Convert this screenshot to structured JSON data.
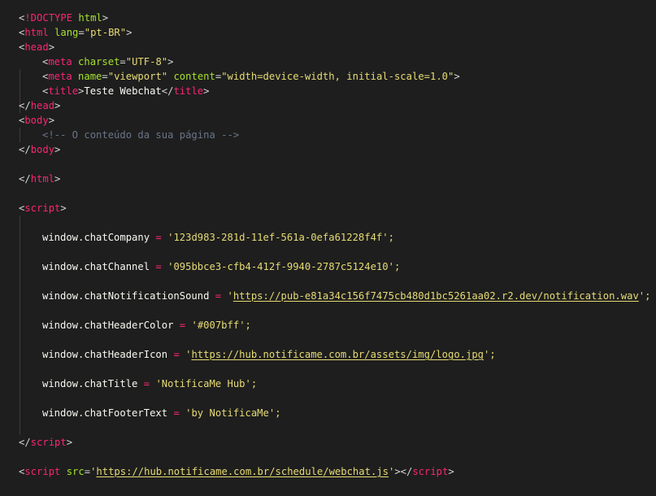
{
  "editor": {
    "language": "html",
    "theme_colors": {
      "background": "#1e1e1e",
      "tag": "#f92672",
      "attribute": "#a6e22e",
      "string": "#e6db74",
      "comment": "#6a7589",
      "text": "#f8f8f2"
    },
    "lines": {
      "l1": {
        "doctype_kw": "!DOCTYPE",
        "doctype_val": "html"
      },
      "l2": {
        "tag": "html",
        "attr": "lang",
        "val": "\"pt-BR\""
      },
      "l3": {
        "tag": "head"
      },
      "l4": {
        "tag": "meta",
        "attr": "charset",
        "val": "\"UTF-8\""
      },
      "l5": {
        "tag": "meta",
        "attr1": "name",
        "val1": "\"viewport\"",
        "attr2": "content",
        "val2": "\"width=device-width, initial-scale=1.0\""
      },
      "l6": {
        "tag": "title",
        "text": "Teste Webchat",
        "close_tag": "title"
      },
      "l7": {
        "tag": "head"
      },
      "l8": {
        "tag": "body"
      },
      "l9": {
        "comment": "<!-- O conteúdo da sua página -->"
      },
      "l10": {
        "tag": "body"
      },
      "l12": {
        "tag": "html"
      },
      "l14": {
        "tag": "script"
      },
      "l16": {
        "lhs": "window.chatCompany",
        "op": "=",
        "q": "'",
        "val": "123d983-281d-11ef-561a-0efa61228f4f",
        "end": "';"
      },
      "l18": {
        "lhs": "window.chatChannel",
        "op": "=",
        "q": "'",
        "val": "095bbce3-cfb4-412f-9940-2787c5124e10",
        "end": "';"
      },
      "l20": {
        "lhs": "window.chatNotificationSound",
        "op": "=",
        "q": "'",
        "val": "https://pub-e81a34c156f7475cb480d1bc5261aa02.r2.dev/notification.wav",
        "end": "';"
      },
      "l22": {
        "lhs": "window.chatHeaderColor",
        "op": "=",
        "q": "'",
        "val": "#007bff",
        "end": "';"
      },
      "l24": {
        "lhs": "window.chatHeaderIcon",
        "op": "=",
        "q": "'",
        "val": "https://hub.notificame.com.br/assets/img/logo.jpg",
        "end": "';"
      },
      "l26": {
        "lhs": "window.chatTitle",
        "op": "=",
        "q": "'",
        "val": "NotificaMe Hub",
        "end": "';"
      },
      "l28": {
        "lhs": "window.chatFooterText",
        "op": "=",
        "q": "'",
        "val": "by NotificaMe",
        "end": "';"
      },
      "l30": {
        "tag": "script"
      },
      "l32": {
        "tag": "script",
        "attr": "src",
        "q": "'",
        "val": "https://hub.notificame.com.br/schedule/webchat.js",
        "close_tag": "script"
      }
    }
  }
}
